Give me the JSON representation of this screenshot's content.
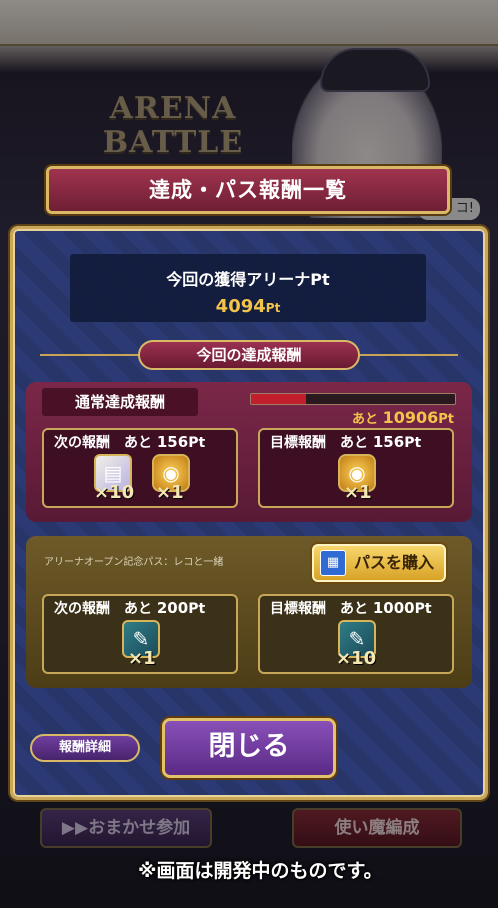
{
  "background": {
    "logo_line1": "ARENA",
    "logo_line2": "BATTLE",
    "bubble_text": "コ!",
    "auto_join_label": "▶▶おまかせ参加",
    "familiar_edit_label": "使い魔編成"
  },
  "dialog": {
    "title": "達成・パス報酬一覧",
    "earned_label": "今回の獲得アリーナPt",
    "earned_value": "4094",
    "earned_unit": "Pt",
    "section_tab": "今回の達成報酬"
  },
  "normal_rewards": {
    "header": "通常達成報酬",
    "progress_fraction": 0.27,
    "remaining_prefix": "あと",
    "remaining_value": "10906",
    "remaining_unit": "Pt",
    "next": {
      "label": "次の報酬",
      "remain": "あと",
      "pt": "156",
      "unit": "Pt",
      "items": [
        {
          "icon": "ticket-icon",
          "qty": "×10"
        },
        {
          "icon": "coin-icon",
          "qty": "×1"
        }
      ]
    },
    "goal": {
      "label": "目標報酬",
      "remain": "あと",
      "pt": "156",
      "unit": "Pt",
      "items": [
        {
          "icon": "coin-icon",
          "qty": "×1"
        }
      ]
    }
  },
  "pass_rewards": {
    "pass_name": "アリーナオープン記念パス：レコと一緒",
    "buy_label": "パスを購入",
    "next": {
      "label": "次の報酬",
      "remain": "あと",
      "pt": "200",
      "unit": "Pt",
      "items": [
        {
          "icon": "scroll-icon",
          "qty": "×1"
        }
      ]
    },
    "goal": {
      "label": "目標報酬",
      "remain": "あと",
      "pt": "1000",
      "unit": "Pt",
      "items": [
        {
          "icon": "scroll-icon",
          "qty": "×10"
        }
      ]
    }
  },
  "buttons": {
    "detail": "報酬詳細",
    "close": "閉じる"
  },
  "notice": "※画面は開発中のものです。",
  "colors": {
    "accent_gold": "#c8a858",
    "pt_yellow": "#f3c44a",
    "progress_red": "#c21e2e"
  }
}
